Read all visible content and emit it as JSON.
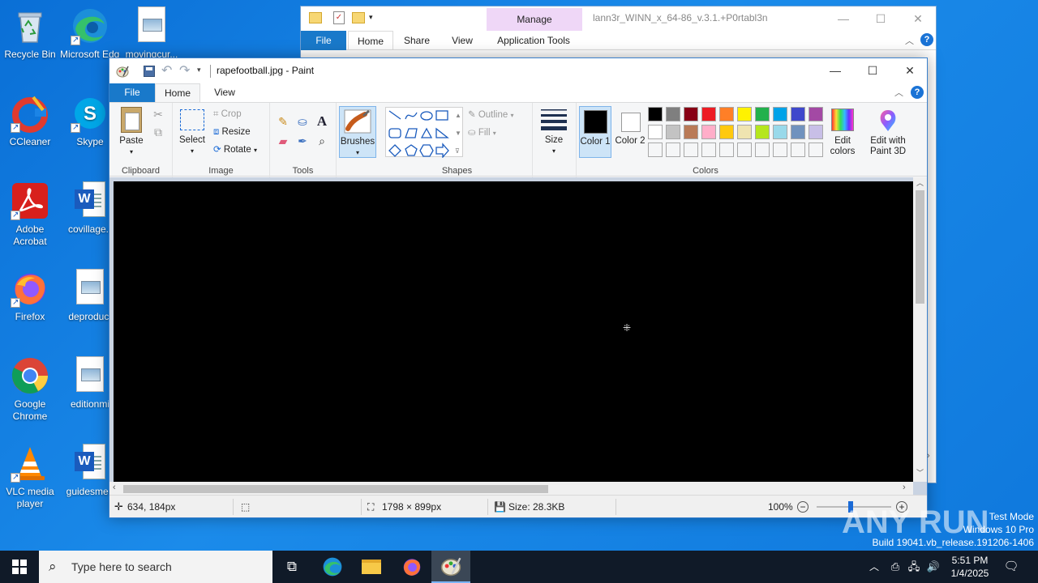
{
  "desktop": {
    "icons": [
      {
        "label": "Recycle Bin"
      },
      {
        "label": "Microsoft Edge"
      },
      {
        "label": "movingcur..."
      },
      {
        "label": "CCleaner"
      },
      {
        "label": "Skype"
      },
      {
        "label": "Adobe Acrobat"
      },
      {
        "label": "covillage.r"
      },
      {
        "label": "Firefox"
      },
      {
        "label": "deproduct"
      },
      {
        "label": "Google Chrome"
      },
      {
        "label": "editionmi"
      },
      {
        "label": "VLC media player"
      },
      {
        "label": "guidesmed"
      }
    ]
  },
  "explorer": {
    "title": "lann3r_WINN_x_64-86_v.3.1.+P0rtabl3n",
    "manage_label": "Manage",
    "tabs": [
      "File",
      "Home",
      "Share",
      "View",
      "Application Tools"
    ]
  },
  "paint": {
    "title": "rapefootball.jpg - Paint",
    "tabs": {
      "file": "File",
      "home": "Home",
      "view": "View"
    },
    "clipboard": {
      "paste": "Paste",
      "group": "Clipboard"
    },
    "image": {
      "select": "Select",
      "crop": "Crop",
      "resize": "Resize",
      "rotate": "Rotate",
      "group": "Image"
    },
    "tools": {
      "group": "Tools",
      "brushes": "Brushes"
    },
    "shapes": {
      "outline": "Outline",
      "fill": "Fill",
      "group": "Shapes"
    },
    "size": {
      "label": "Size"
    },
    "colors": {
      "color1": "Color 1",
      "color2": "Color 2",
      "edit_colors": "Edit colors",
      "edit_paint3d": "Edit with Paint 3D",
      "group": "Colors",
      "palette_row1": [
        "#000000",
        "#7f7f7f",
        "#880015",
        "#ed1c24",
        "#ff7f27",
        "#fff200",
        "#22b14c",
        "#00a2e8",
        "#3f48cc",
        "#a349a4"
      ],
      "palette_row2": [
        "#ffffff",
        "#c3c3c3",
        "#b97a57",
        "#ffaec9",
        "#ffc90e",
        "#efe4b0",
        "#b5e61d",
        "#99d9ea",
        "#7092be",
        "#c8bfe7"
      ],
      "color1_value": "#000000",
      "color2_value": "#ffffff"
    },
    "status": {
      "cursor_pos": "634, 184px",
      "dimensions": "1798 × 899px",
      "size": "Size: 28.3KB",
      "zoom": "100%"
    }
  },
  "taskbar": {
    "search_placeholder": "Type here to search",
    "time": "5:51 PM",
    "date": "1/4/2025"
  },
  "watermark": {
    "mode": "Test Mode",
    "os": "Windows 10 Pro",
    "build": "Build 19041.vb_release.191206-1406",
    "brand": "ANY RUN"
  }
}
